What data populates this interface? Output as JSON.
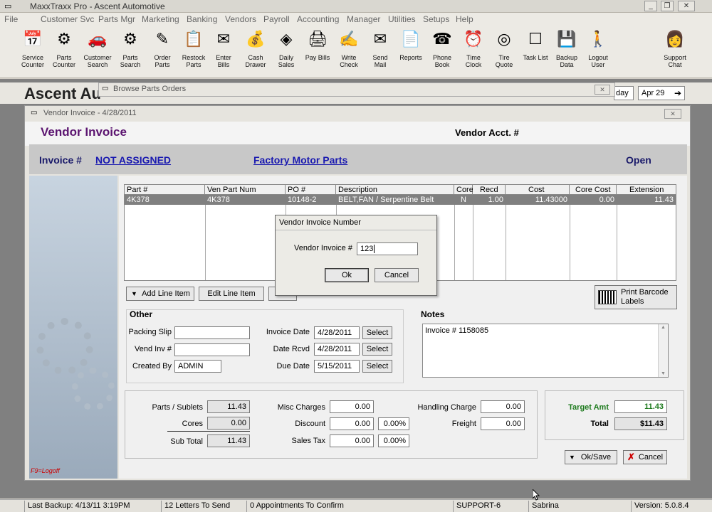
{
  "app": {
    "title": "MaxxTraxx Pro - Ascent Automotive"
  },
  "menu": [
    "File",
    "Customer Svc",
    "Parts Mgr",
    "Marketing",
    "Banking",
    "Vendors",
    "Payroll",
    "Accounting",
    "Manager",
    "Utilities",
    "Setups",
    "Help"
  ],
  "toolbar": [
    {
      "label": "Service\nCounter",
      "icon": "service-counter-icon",
      "glyph": "📅"
    },
    {
      "label": "Parts\nCounter",
      "icon": "parts-counter-icon",
      "glyph": "⚙"
    },
    {
      "label": "Customer\nSearch",
      "icon": "car-icon",
      "glyph": "🚗"
    },
    {
      "label": "Parts\nSearch",
      "icon": "gear-search-icon",
      "glyph": "⚙"
    },
    {
      "label": "Order\nParts",
      "icon": "order-icon",
      "glyph": "✎"
    },
    {
      "label": "Restock\nParts",
      "icon": "clipboard-icon",
      "glyph": "📋"
    },
    {
      "label": "Enter\nBills",
      "icon": "bills-icon",
      "glyph": "✉"
    },
    {
      "label": "Cash\nDrawer",
      "icon": "money-bag-icon",
      "glyph": "💰"
    },
    {
      "label": "Daily\nSales",
      "icon": "daily-sales-icon",
      "glyph": "◈"
    },
    {
      "label": "Pay Bills",
      "icon": "pay-bills-icon",
      "glyph": "🖨"
    },
    {
      "label": "Write\nCheck",
      "icon": "check-icon",
      "glyph": "✍"
    },
    {
      "label": "Send\nMail",
      "icon": "mail-icon",
      "glyph": "✉"
    },
    {
      "label": "Reports",
      "icon": "reports-icon",
      "glyph": "📄"
    },
    {
      "label": "Phone\nBook",
      "icon": "phone-icon",
      "glyph": "☎"
    },
    {
      "label": "Time\nClock",
      "icon": "clock-icon",
      "glyph": "⏰"
    },
    {
      "label": "Tire\nQuote",
      "icon": "tire-icon",
      "glyph": "◎"
    },
    {
      "label": "Task List",
      "icon": "tasklist-icon",
      "glyph": "☐"
    },
    {
      "label": "Backup\nData",
      "icon": "floppy-icon",
      "glyph": "💾"
    },
    {
      "label": "Logout\nUser",
      "icon": "logout-icon",
      "glyph": "🚶"
    },
    {
      "label": "Support\nChat",
      "icon": "support-icon",
      "glyph": "👩"
    }
  ],
  "background": {
    "title": "Ascent Au",
    "browse_title": "Browse Parts Orders",
    "day": "day",
    "date": "Apr 29"
  },
  "invoice_window": {
    "title": "Vendor Invoice - 4/28/2011",
    "heading": "Vendor Invoice",
    "vendor_acct_label": "Vendor Acct. #",
    "invoice_label": "Invoice #",
    "invoice_value": "NOT ASSIGNED",
    "vendor_name": "Factory Motor Parts",
    "status": "Open",
    "grid": {
      "headers": [
        "Part #",
        "Ven Part Num",
        "PO #",
        "Description",
        "Core",
        "Recd",
        "Cost",
        "Core Cost",
        "Extension"
      ],
      "rows": [
        [
          "4K378",
          "4K378",
          "10148-2",
          "BELT,FAN / Serpentine Belt",
          "N",
          "1.00",
          "11.43000",
          "0.00",
          "11.43"
        ]
      ]
    },
    "add_line_item": "Add Line Item",
    "edit_line_item": "Edit Line Item",
    "print_barcode": "Print Barcode Labels",
    "other": {
      "heading": "Other",
      "packing_slip_label": "Packing Slip",
      "packing_slip": "",
      "vend_inv_label": "Vend Inv #",
      "vend_inv": "",
      "created_by_label": "Created By",
      "created_by": "ADMIN",
      "invoice_date_label": "Invoice Date",
      "invoice_date": "4/28/2011",
      "date_recd_label": "Date Rcvd",
      "date_recd": "4/28/2011",
      "due_date_label": "Due Date",
      "due_date": "5/15/2011",
      "select": "Select"
    },
    "notes": {
      "heading": "Notes",
      "text": "Invoice #  1158085"
    },
    "totals": {
      "parts_sublets_label": "Parts / Sublets",
      "parts_sublets": "11.43",
      "cores_label": "Cores",
      "cores": "0.00",
      "subtotal_label": "Sub Total",
      "subtotal": "11.43",
      "misc_label": "Misc Charges",
      "misc": "0.00",
      "discount_label": "Discount",
      "discount": "0.00",
      "discount_pct": "0.00%",
      "salestax_label": "Sales Tax",
      "salestax": "0.00",
      "salestax_pct": "0.00%",
      "handling_label": "Handling Charge",
      "handling": "0.00",
      "freight_label": "Freight",
      "freight": "0.00",
      "target_label": "Target Amt",
      "target": "11.43",
      "total_label": "Total",
      "total": "$11.43"
    },
    "ok_save": "Ok/Save",
    "cancel": "Cancel",
    "logoff": "F9=Logoff"
  },
  "dialog": {
    "title": "Vendor Invoice Number",
    "label": "Vendor Invoice #",
    "value": "123",
    "ok": "Ok",
    "cancel": "Cancel"
  },
  "status": {
    "last_backup": "Last Backup:  4/13/11   3:19PM",
    "letters": "12 Letters To Send",
    "appointments": "0 Appointments To Confirm",
    "station": "SUPPORT-6",
    "user": "Sabrina",
    "version": "Version:  5.0.8.4"
  }
}
